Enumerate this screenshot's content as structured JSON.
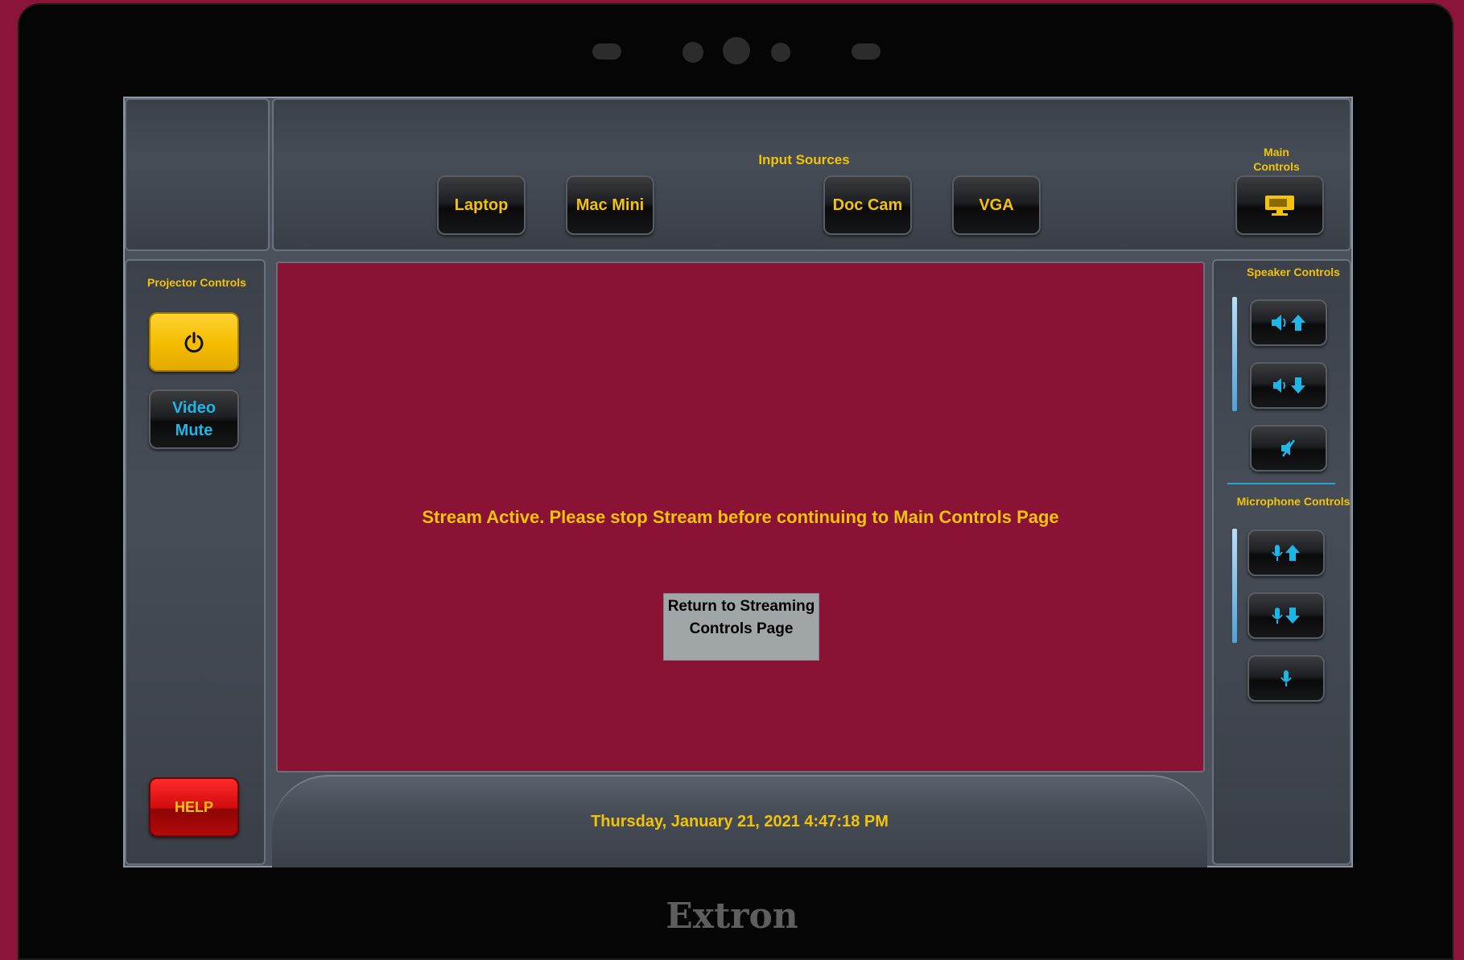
{
  "device": {
    "brand": "Extron"
  },
  "header": {
    "input_sources_label": "Input Sources",
    "inputs": [
      {
        "label": "Laptop"
      },
      {
        "label": "Mac Mini"
      },
      {
        "label": "Doc Cam"
      },
      {
        "label": "VGA"
      }
    ],
    "main_controls_label": "Main Controls"
  },
  "left_panel": {
    "projector_controls_label": "Projector Controls",
    "video_mute_line1": "Video",
    "video_mute_line2": "Mute",
    "help_label": "HELP"
  },
  "right_panel": {
    "speaker_controls_label": "Speaker Controls",
    "microphone_controls_label": "Microphone Controls"
  },
  "main": {
    "status_message": "Stream Active.  Please stop Stream before continuing to Main Controls Page",
    "return_button_label": "Return to Streaming Controls Page"
  },
  "footer": {
    "datetime": "Thursday, January 21, 2021 4:47:18 PM"
  },
  "colors": {
    "accent": "#f2c30a",
    "content_bg": "#8a1235",
    "icon_cyan": "#1db6e6",
    "help_red": "#d10d0d"
  }
}
